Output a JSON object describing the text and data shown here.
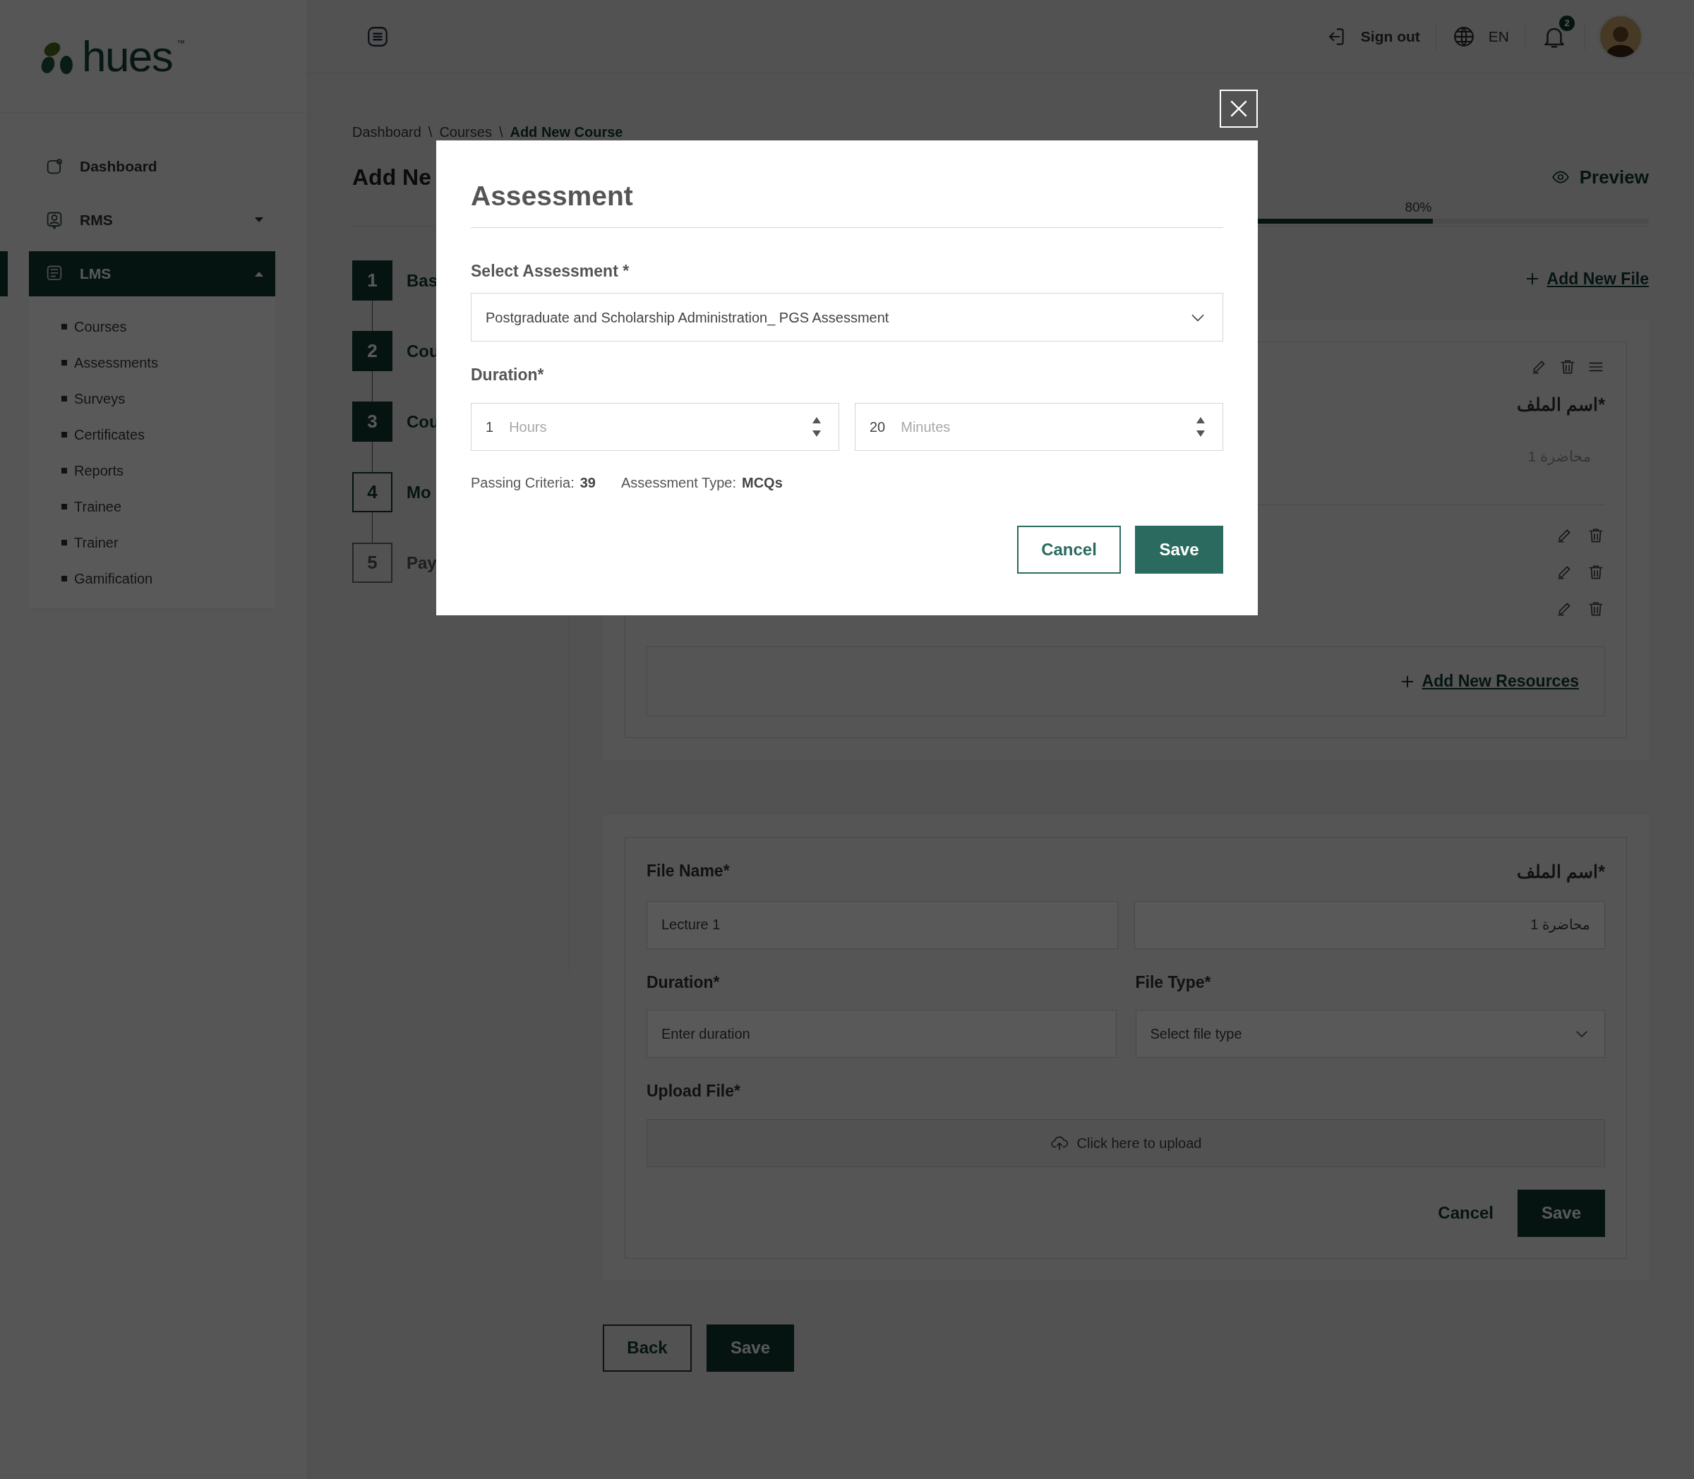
{
  "logo": {
    "text": "hues",
    "mark": "™"
  },
  "header": {
    "sign_out": "Sign out",
    "language": "EN",
    "notifications": "2"
  },
  "sidebar": {
    "items": [
      {
        "label": "Dashboard",
        "kind": "link",
        "selected": false
      },
      {
        "label": "RMS",
        "kind": "group",
        "selected": false,
        "expanded": false
      },
      {
        "label": "LMS",
        "kind": "group",
        "selected": true,
        "expanded": true,
        "children": [
          {
            "label": "Courses",
            "selected": false
          },
          {
            "label": "Assessments",
            "selected": false
          },
          {
            "label": "Surveys",
            "selected": false
          },
          {
            "label": "Certificates",
            "selected": false
          },
          {
            "label": "Reports",
            "selected": false
          },
          {
            "label": "Trainee",
            "selected": false
          },
          {
            "label": "Trainer",
            "selected": false
          },
          {
            "label": "Gamification",
            "selected": false
          }
        ]
      }
    ]
  },
  "breadcrumb": [
    {
      "label": "Dashboard",
      "current": false,
      "separator": "\\"
    },
    {
      "label": "Courses",
      "current": false,
      "separator": "\\"
    },
    {
      "label": "Add New Course",
      "current": true
    }
  ],
  "page_title": "Add Ne",
  "preview": "Preview",
  "progress": {
    "level": 0.8,
    "reading": "80%"
  },
  "steps": [
    {
      "number": "1",
      "label": "Bas",
      "done": true,
      "current": false
    },
    {
      "number": "2",
      "label": "Cou",
      "done": true,
      "current": false
    },
    {
      "number": "3",
      "label": "Cou",
      "done": true,
      "current": false
    },
    {
      "number": "4",
      "label": "Mo",
      "done": false,
      "current": true
    },
    {
      "number": "5",
      "label": "Pay",
      "done": false,
      "current": false
    }
  ],
  "add_file": "Add New File",
  "file_card": {
    "arabic_label": "اسم الملف*",
    "arabic_value": "محاضرة 1",
    "add_resources": "Add New Resources"
  },
  "new_file_form": {
    "file_name_label": "File Name*",
    "arabic_label": "اسم الملف*",
    "file_name_placeholder": "Lecture 1",
    "arabic_placeholder": "محاضرة 1",
    "duration_label": "Duration*",
    "duration_placeholder": "Enter duration",
    "file_type_label": "File Type*",
    "file_type_placeholder": "Select file type",
    "upload_label": "Upload File*",
    "upload_text": "Click here to upload",
    "cancel": "Cancel",
    "save": "Save"
  },
  "footer": {
    "back": "Back",
    "save": "Save"
  },
  "modal": {
    "title": "Assessment",
    "select_label": "Select Assessment *",
    "select_value": "Postgraduate and Scholarship Administration_ PGS Assessment",
    "duration_label": "Duration*",
    "hours": {
      "value": "1",
      "unit": "Hours"
    },
    "minutes": {
      "value": "20",
      "unit": "Minutes"
    },
    "info": [
      {
        "label": "Passing Criteria:",
        "value": "39"
      },
      {
        "label": "Assessment Type:",
        "value": "MCQs"
      }
    ],
    "cancel": "Cancel",
    "save": "Save"
  }
}
